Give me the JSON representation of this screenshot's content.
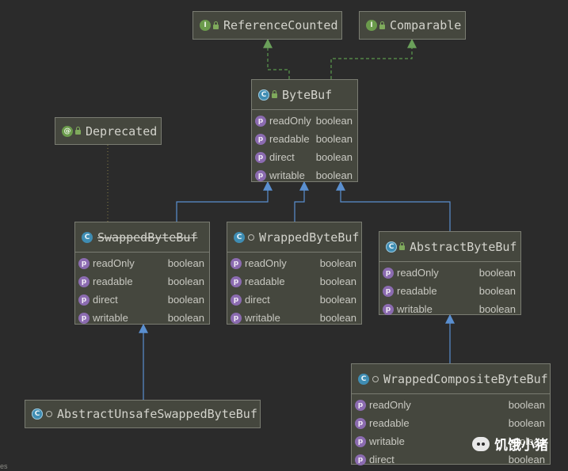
{
  "colors": {
    "background": "#2b2b2b",
    "node_fill": "#45473e",
    "node_border": "#7a7c72",
    "implements_edge": "#5b9a4e",
    "extends_edge": "#5a8fd0",
    "annotation_edge": "#8a7f4a"
  },
  "nodes": {
    "reference_counted": {
      "name": "ReferenceCounted",
      "kind": "interface"
    },
    "comparable": {
      "name": "Comparable",
      "kind": "interface"
    },
    "bytebuf": {
      "name": "ByteBuf",
      "kind": "abstract-class",
      "props": [
        {
          "name": "readOnly",
          "type": "boolean"
        },
        {
          "name": "readable",
          "type": "boolean"
        },
        {
          "name": "direct",
          "type": "boolean"
        },
        {
          "name": "writable",
          "type": "boolean"
        }
      ]
    },
    "deprecated": {
      "name": "Deprecated",
      "kind": "annotation"
    },
    "swapped": {
      "name": "SwappedByteBuf",
      "kind": "class",
      "deprecated": true,
      "props": [
        {
          "name": "readOnly",
          "type": "boolean"
        },
        {
          "name": "readable",
          "type": "boolean"
        },
        {
          "name": "direct",
          "type": "boolean"
        },
        {
          "name": "writable",
          "type": "boolean"
        }
      ]
    },
    "wrapped": {
      "name": "WrappedByteBuf",
      "kind": "class",
      "props": [
        {
          "name": "readOnly",
          "type": "boolean"
        },
        {
          "name": "readable",
          "type": "boolean"
        },
        {
          "name": "direct",
          "type": "boolean"
        },
        {
          "name": "writable",
          "type": "boolean"
        }
      ]
    },
    "abstractbb": {
      "name": "AbstractByteBuf",
      "kind": "abstract-class",
      "props": [
        {
          "name": "readOnly",
          "type": "boolean"
        },
        {
          "name": "readable",
          "type": "boolean"
        },
        {
          "name": "writable",
          "type": "boolean"
        }
      ]
    },
    "unsafe_swapped": {
      "name": "AbstractUnsafeSwappedByteBuf",
      "kind": "abstract-class"
    },
    "wrapped_composite": {
      "name": "WrappedCompositeByteBuf",
      "kind": "class",
      "props": [
        {
          "name": "readOnly",
          "type": "boolean"
        },
        {
          "name": "readable",
          "type": "boolean"
        },
        {
          "name": "writable",
          "type": "boolean"
        },
        {
          "name": "direct",
          "type": "boolean"
        }
      ]
    }
  },
  "edges": [
    {
      "from": "bytebuf",
      "to": "reference_counted",
      "kind": "implements"
    },
    {
      "from": "bytebuf",
      "to": "comparable",
      "kind": "implements"
    },
    {
      "from": "swapped",
      "to": "bytebuf",
      "kind": "extends"
    },
    {
      "from": "wrapped",
      "to": "bytebuf",
      "kind": "extends"
    },
    {
      "from": "abstractbb",
      "to": "bytebuf",
      "kind": "extends"
    },
    {
      "from": "swapped",
      "to": "deprecated",
      "kind": "annotated"
    },
    {
      "from": "unsafe_swapped",
      "to": "swapped",
      "kind": "extends"
    },
    {
      "from": "wrapped_composite",
      "to": "abstractbb",
      "kind": "extends"
    }
  ],
  "watermark": {
    "text": "饥饿小猪"
  },
  "corner_text": "es"
}
